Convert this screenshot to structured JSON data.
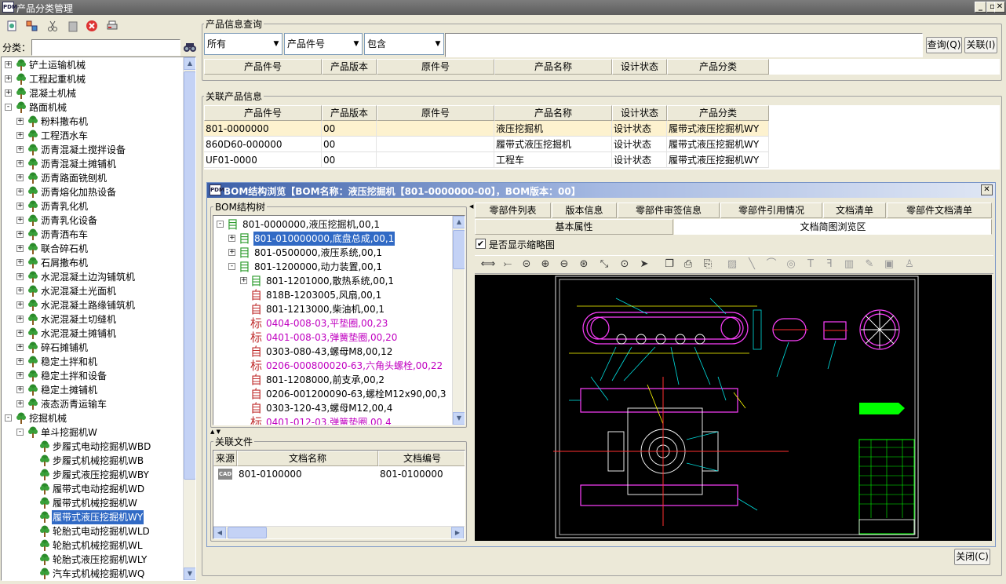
{
  "window": {
    "title": "产品分类管理",
    "app_icon": "PDM"
  },
  "left": {
    "category_label": "分类：",
    "category_value": "",
    "tree": [
      {
        "label": "铲土运输机械",
        "level": 0,
        "exp": "+"
      },
      {
        "label": "工程起重机械",
        "level": 0,
        "exp": "+"
      },
      {
        "label": "混凝土机械",
        "level": 0,
        "exp": "+"
      },
      {
        "label": "路面机械",
        "level": 0,
        "exp": "-"
      },
      {
        "label": "粉料撒布机",
        "level": 1,
        "exp": "+"
      },
      {
        "label": "工程洒水车",
        "level": 1,
        "exp": "+"
      },
      {
        "label": "沥青混凝土搅拌设备",
        "level": 1,
        "exp": "+"
      },
      {
        "label": "沥青混凝土摊铺机",
        "level": 1,
        "exp": "+"
      },
      {
        "label": "沥青路面铣刨机",
        "level": 1,
        "exp": "+"
      },
      {
        "label": "沥青熔化加热设备",
        "level": 1,
        "exp": "+"
      },
      {
        "label": "沥青乳化机",
        "level": 1,
        "exp": "+"
      },
      {
        "label": "沥青乳化设备",
        "level": 1,
        "exp": "+"
      },
      {
        "label": "沥青洒布车",
        "level": 1,
        "exp": "+"
      },
      {
        "label": "联合碎石机",
        "level": 1,
        "exp": "+"
      },
      {
        "label": "石屑撒布机",
        "level": 1,
        "exp": "+"
      },
      {
        "label": "水泥混凝土边沟铺筑机",
        "level": 1,
        "exp": "+"
      },
      {
        "label": "水泥混凝土光面机",
        "level": 1,
        "exp": "+"
      },
      {
        "label": "水泥混凝土路缘铺筑机",
        "level": 1,
        "exp": "+"
      },
      {
        "label": "水泥混凝土切缝机",
        "level": 1,
        "exp": "+"
      },
      {
        "label": "水泥混凝土摊铺机",
        "level": 1,
        "exp": "+"
      },
      {
        "label": "碎石摊铺机",
        "level": 1,
        "exp": "+"
      },
      {
        "label": "稳定土拌和机",
        "level": 1,
        "exp": "+"
      },
      {
        "label": "稳定土拌和设备",
        "level": 1,
        "exp": "+"
      },
      {
        "label": "稳定土摊铺机",
        "level": 1,
        "exp": "+"
      },
      {
        "label": "液态沥青运输车",
        "level": 1,
        "exp": "+"
      },
      {
        "label": "挖掘机械",
        "level": 0,
        "exp": "-"
      },
      {
        "label": "单斗挖掘机W",
        "level": 1,
        "exp": "-"
      },
      {
        "label": "步履式电动挖掘机WBD",
        "level": 2,
        "exp": ""
      },
      {
        "label": "步履式机械挖掘机WB",
        "level": 2,
        "exp": ""
      },
      {
        "label": "步履式液压挖掘机WBY",
        "level": 2,
        "exp": ""
      },
      {
        "label": "履带式电动挖掘机WD",
        "level": 2,
        "exp": ""
      },
      {
        "label": "履带式机械挖掘机W",
        "level": 2,
        "exp": ""
      },
      {
        "label": "履带式液压挖掘机WY",
        "level": 2,
        "exp": "",
        "selected": true
      },
      {
        "label": "轮胎式电动挖掘机WLD",
        "level": 2,
        "exp": ""
      },
      {
        "label": "轮胎式机械挖掘机WL",
        "level": 2,
        "exp": ""
      },
      {
        "label": "轮胎式液压挖掘机WLY",
        "level": 2,
        "exp": ""
      },
      {
        "label": "汽车式机械挖掘机WQ",
        "level": 2,
        "exp": ""
      }
    ]
  },
  "query": {
    "title": "产品信息查询",
    "combo1": "所有",
    "combo2": "产品件号",
    "combo3": "包含",
    "search_value": "",
    "query_button": "查询(Q)",
    "close_button": "关联(I)",
    "columns": [
      "产品件号",
      "产品版本",
      "原件号",
      "产品名称",
      "设计状态",
      "产品分类"
    ]
  },
  "related": {
    "title": "关联产品信息",
    "columns": [
      "产品件号",
      "产品版本",
      "原件号",
      "产品名称",
      "设计状态",
      "产品分类"
    ],
    "rows": [
      [
        "801-0000000",
        "00",
        "",
        "液压挖掘机",
        "设计状态",
        "履带式液压挖掘机WY"
      ],
      [
        "860D60-000000",
        "00",
        "",
        "履带式液压挖掘机",
        "设计状态",
        "履带式液压挖掘机WY"
      ],
      [
        "UF01-0000",
        "00",
        "",
        "工程车",
        "设计状态",
        "履带式液压挖掘机WY"
      ]
    ]
  },
  "bom": {
    "title": "BOM结构浏览【BOM名称：液压挖掘机【801-0000000-00】，BOM版本：00】",
    "tree_title": "BOM结构树",
    "rows": [
      {
        "text": "801-0000000,液压挖掘机,00,1",
        "icon": "目",
        "lvl": 0,
        "exp": "-"
      },
      {
        "text": "801-010000000,底盘总成,00,1",
        "icon": "目",
        "lvl": 1,
        "exp": "+",
        "selected": true
      },
      {
        "text": "801-0500000,液压系统,00,1",
        "icon": "目",
        "lvl": 1,
        "exp": "+"
      },
      {
        "text": "801-1200000,动力装置,00,1",
        "icon": "目",
        "lvl": 1,
        "exp": "-"
      },
      {
        "text": "801-1201000,散热系统,00,1",
        "icon": "目",
        "lvl": 2,
        "exp": "+"
      },
      {
        "text": "818B-1203005,风扇,00,1",
        "icon": "自",
        "lvl": 2,
        "exp": ""
      },
      {
        "text": "801-1213000,柴油机,00,1",
        "icon": "自",
        "lvl": 2,
        "exp": ""
      },
      {
        "text": "0404-008-03,平垫圈,00,23",
        "icon": "标",
        "lvl": 2,
        "exp": "",
        "mag": true
      },
      {
        "text": "0401-008-03,弹簧垫圈,00,20",
        "icon": "标",
        "lvl": 2,
        "exp": "",
        "mag": true
      },
      {
        "text": "0303-080-43,螺母M8,00,12",
        "icon": "自",
        "lvl": 2,
        "exp": ""
      },
      {
        "text": "0206-000800020-63,六角头螺栓,00,22",
        "icon": "标",
        "lvl": 2,
        "exp": "",
        "mag": true
      },
      {
        "text": "801-1208000,前支承,00,2",
        "icon": "自",
        "lvl": 2,
        "exp": ""
      },
      {
        "text": "0206-001200090-63,螺栓M12x90,00,3",
        "icon": "自",
        "lvl": 2,
        "exp": ""
      },
      {
        "text": "0303-120-43,螺母M12,00,4",
        "icon": "自",
        "lvl": 2,
        "exp": ""
      },
      {
        "text": "0401-012-03,弹簧垫圈,00,4",
        "icon": "标",
        "lvl": 2,
        "exp": "",
        "mag": true
      }
    ],
    "files_title": "关联文件",
    "file_columns": [
      "来源",
      "文档名称",
      "文档编号"
    ],
    "files": [
      {
        "source_icon": "CAD",
        "name": "801-0100000",
        "code": "801-0100000"
      }
    ],
    "tabs_row1": [
      "零部件列表",
      "版本信息",
      "零部件审签信息",
      "零部件引用情况",
      "文档清单",
      "零部件文档清单"
    ],
    "tabs_row2": [
      "基本属性",
      "文档简图浏览区"
    ],
    "thumb_checkbox": "是否显示缩略图",
    "thumb_checked": true,
    "close_button": "关闭(C)"
  }
}
